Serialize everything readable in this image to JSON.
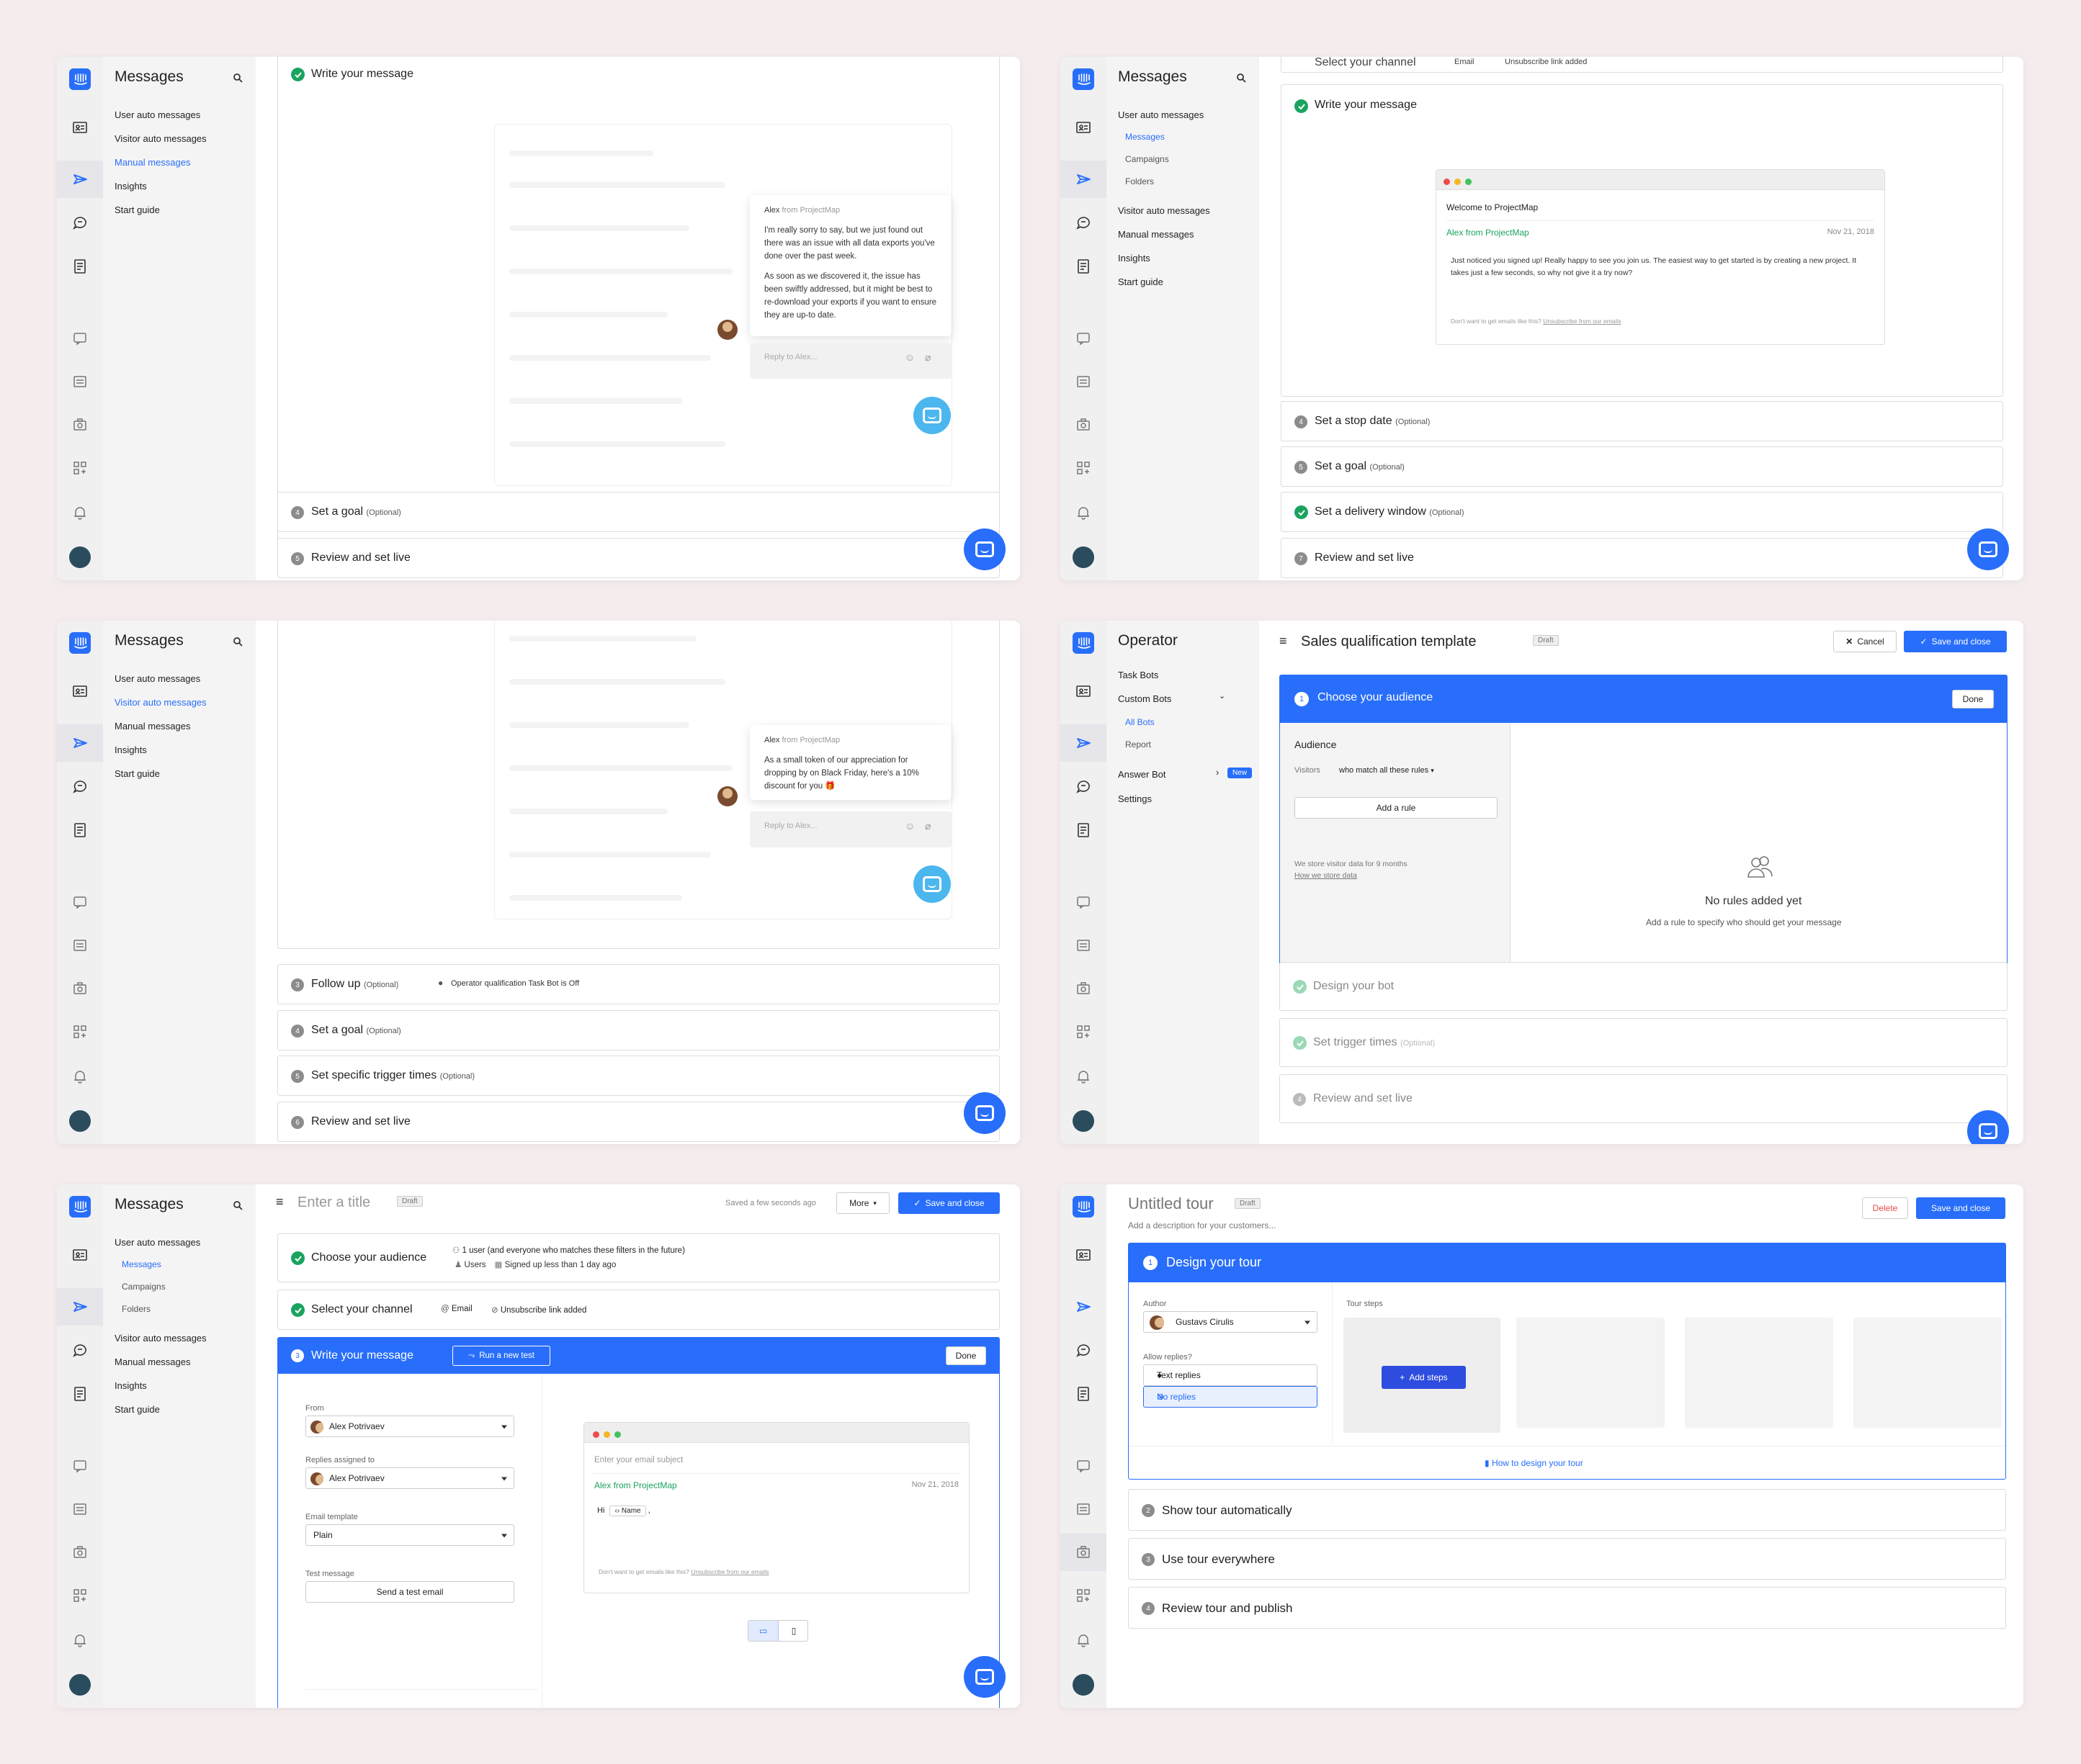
{
  "colors": {
    "accent": "#286efa",
    "success": "#1aa35f",
    "background": "#f5eced",
    "chat_fab": "#4bb7ee"
  },
  "p1": {
    "nav_title": "Messages",
    "nav_items": [
      "User auto messages",
      "Visitor auto messages",
      "Manual messages",
      "Insights",
      "Start guide"
    ],
    "step_write": "Write your message",
    "chat_author": "Alex",
    "chat_from": " from ProjectMap",
    "chat_p1": "I'm really sorry to say, but we just found out there was an issue with all data exports you've done over the past week.",
    "chat_p2": "As soon as we discovered it, the issue has been swiftly addressed, but it might be best to re-download your exports if you want to ensure they are up-to date.",
    "reply_placeholder": "Reply to Alex...",
    "step4": "Set a goal",
    "step4_opt": "(Optional)",
    "step5": "Review and set live",
    "num4": "4",
    "num5": "5"
  },
  "p2": {
    "nav_title": "Messages",
    "nav_group": "User auto messages",
    "nav_sub": [
      "Messages",
      "Campaigns",
      "Folders"
    ],
    "nav_items": [
      "Visitor auto messages",
      "Manual messages",
      "Insights",
      "Start guide"
    ],
    "cut_text": "Select your channel",
    "cut_text2": "Email",
    "cut_text3": "Unsubscribe link added",
    "step_write": "Write your message",
    "email_title": "Welcome to ProjectMap",
    "email_from": "Alex from ProjectMap",
    "email_date": "Nov 21, 2018",
    "email_body": "Just noticed you signed up! Really happy to see you join us. The easiest way to get started is by creating a new project. It takes just a few seconds, so why not give it a try now?",
    "email_footer": "Don't want to get emails like this?",
    "email_unsub": "Unsubscribe from our emails",
    "step4": "Set a stop date",
    "step5": "Set a goal",
    "step6": "Set a delivery window",
    "step7": "Review and set live",
    "opt": "(Optional)",
    "num4": "4",
    "num5": "5",
    "num7": "7"
  },
  "p3": {
    "nav_title": "Messages",
    "nav_items": [
      "User auto messages",
      "Visitor auto messages",
      "Manual messages",
      "Insights",
      "Start guide"
    ],
    "chat_author": "Alex",
    "chat_from": " from ProjectMap",
    "chat_body": "As a small token of our appreciation for dropping by on Black Friday, here's a 10% discount for you 🎁",
    "reply_placeholder": "Reply to Alex...",
    "step3": "Follow up",
    "step3_note": "Operator qualification Task Bot is Off",
    "step4": "Set a goal",
    "step5": "Set specific trigger times",
    "step6": "Review and set live",
    "opt": "(Optional)",
    "num3": "3",
    "num4": "4",
    "num5": "5",
    "num6": "6"
  },
  "p4": {
    "nav_title": "Operator",
    "nav_items": [
      "Task Bots",
      "Custom Bots",
      "All Bots",
      "Report",
      "Answer Bot",
      "Settings"
    ],
    "new_badge": "New",
    "page_title": "Sales qualification template",
    "draft": "Draft",
    "cancel": "Cancel",
    "save_close": "Save and close",
    "step1_num": "1",
    "step1": "Choose your audience",
    "done": "Done",
    "audience": "Audience",
    "visitors": "Visitors",
    "match": "who match all these rules",
    "add_rule": "Add a rule",
    "store_note": "We store visitor data for 9 months",
    "store_link": "How we store data",
    "empty_title": "No rules added yet",
    "empty_sub": "Add a rule to specify who should get your message",
    "step2": "Design your bot",
    "step3": "Set trigger times",
    "step3_opt": "(Optional)",
    "step4": "Review and set live",
    "num4": "4"
  },
  "p5": {
    "nav_title": "Messages",
    "nav_group": "User auto messages",
    "nav_sub": [
      "Messages",
      "Campaigns",
      "Folders"
    ],
    "nav_items": [
      "Visitor auto messages",
      "Manual messages",
      "Insights",
      "Start guide"
    ],
    "title_placeholder": "Enter a title",
    "draft": "Draft",
    "saved": "Saved a few seconds ago",
    "more": "More",
    "save_close": "Save and close",
    "step1": "Choose your audience",
    "aud_line1": "1 user (and everyone who matches these filters in the future)",
    "aud_users": "Users",
    "aud_signed": "Signed up less than 1 day ago",
    "step2": "Select your channel",
    "ch_email": "Email",
    "ch_unsub": "Unsubscribe link added",
    "step3_num": "3",
    "step3": "Write your message",
    "run_test": "Run a new test",
    "done": "Done",
    "from_lbl": "From",
    "from_val": "Alex Potrivaev",
    "assigned_lbl": "Replies assigned to",
    "assigned_val": "Alex Potrivaev",
    "template_lbl": "Email template",
    "template_val": "Plain",
    "test_lbl": "Test message",
    "send_test": "Send a test email",
    "subject_ph": "Enter your email subject",
    "email_from": "Alex from ProjectMap",
    "email_date": "Nov 21, 2018",
    "hi": "Hi",
    "name_chip": "Name",
    "email_footer": "Don't want to get emails like this?",
    "email_unsub": "Unsubscribe from our emails"
  },
  "p6": {
    "title": "Untitled tour",
    "draft": "Draft",
    "desc": "Add a description for your customers...",
    "delete": "Delete",
    "save_close": "Save and close",
    "step1_num": "1",
    "step1": "Design your tour",
    "author_lbl": "Author",
    "author_val": "Gustavs Cirulis",
    "replies_lbl": "Allow replies?",
    "text_replies": "Text replies",
    "no_replies": "No replies",
    "tour_steps": "Tour steps",
    "add_steps": "Add steps",
    "how_to": "How to design your tour",
    "step2": "Show tour automatically",
    "step3": "Use tour everywhere",
    "step4": "Review tour and publish",
    "num2": "2",
    "num3": "3",
    "num4": "4"
  }
}
